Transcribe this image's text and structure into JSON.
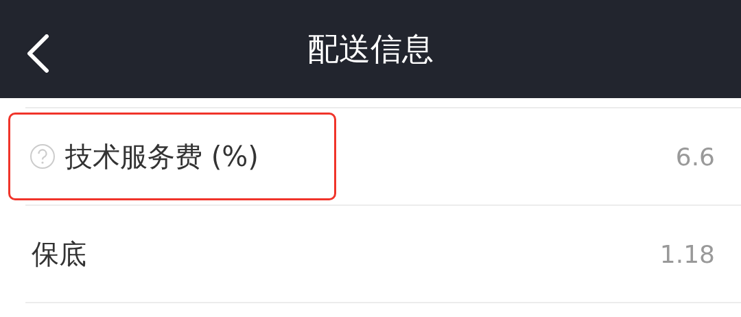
{
  "header": {
    "title": "配送信息"
  },
  "rows": [
    {
      "label": "技术服务费 (%)",
      "value": "6.6",
      "help": true,
      "highlighted": true
    },
    {
      "label": "保底",
      "value": "1.18",
      "help": false,
      "highlighted": false
    }
  ]
}
